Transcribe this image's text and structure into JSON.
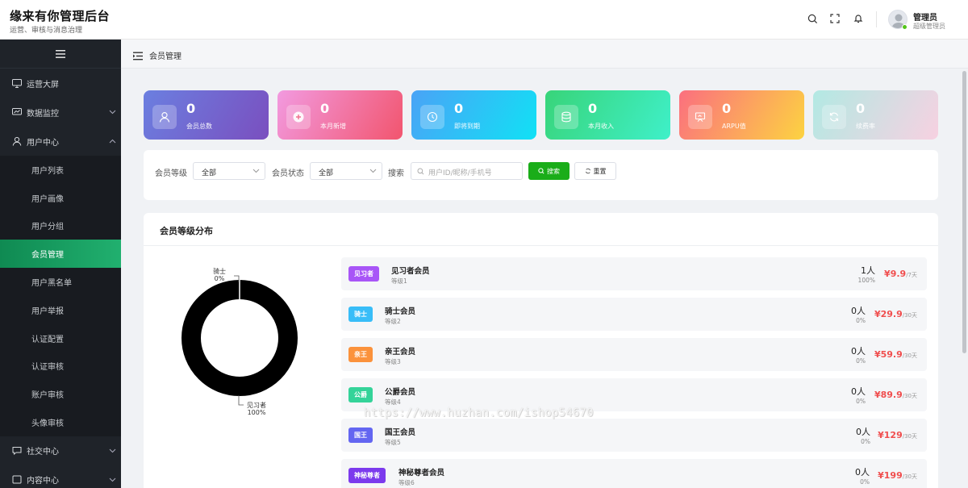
{
  "header": {
    "title": "缘来有你管理后台",
    "subtitle": "运营、审核与消息治理",
    "user_name": "管理员",
    "user_role": "超级管理员"
  },
  "sidebar": {
    "items": [
      {
        "label": "运营大屏",
        "icon": "monitor-icon"
      },
      {
        "label": "数据监控",
        "icon": "chart-icon"
      },
      {
        "label": "用户中心",
        "icon": "user-icon"
      },
      {
        "label": "社交中心",
        "icon": "chat-icon"
      },
      {
        "label": "内容中心",
        "icon": "content-icon"
      }
    ],
    "sub_items": [
      "用户列表",
      "用户画像",
      "用户分组",
      "会员管理",
      "用户黑名单",
      "用户举报",
      "认证配置",
      "认证审核",
      "账户审核",
      "头像审核"
    ],
    "active": "会员管理"
  },
  "breadcrumb": {
    "current": "会员管理"
  },
  "stats": [
    {
      "value": "0",
      "label": "会员总数",
      "icon": "user-icon"
    },
    {
      "value": "0",
      "label": "本月新增",
      "icon": "plus-icon"
    },
    {
      "value": "0",
      "label": "即将到期",
      "icon": "clock-icon"
    },
    {
      "value": "0",
      "label": "本月收入",
      "icon": "database-icon"
    },
    {
      "value": "0",
      "label": "ARPU值",
      "icon": "presentation-icon"
    },
    {
      "value": "0",
      "label": "续费率",
      "icon": "refresh-icon"
    }
  ],
  "filter": {
    "level_label": "会员等级",
    "level_value": "全部",
    "status_label": "会员状态",
    "status_value": "全部",
    "search_label": "搜索",
    "search_placeholder": "用户ID/昵称/手机号",
    "search_button": "搜索",
    "reset_button": "重置"
  },
  "distribution": {
    "title": "会员等级分布",
    "pie_labels": [
      {
        "name": "骑士",
        "pct": "0%"
      },
      {
        "name": "见习者",
        "pct": "100%"
      }
    ],
    "levels": [
      {
        "badge": "见习者",
        "name": "见习者会员",
        "grade": "等级1",
        "count": "1人",
        "pct": "100%",
        "price": "¥9.9",
        "period": "/7天",
        "color": "#a855f7"
      },
      {
        "badge": "骑士",
        "name": "骑士会员",
        "grade": "等级2",
        "count": "0人",
        "pct": "0%",
        "price": "¥29.9",
        "period": "/30天",
        "color": "#38bdf8"
      },
      {
        "badge": "亲王",
        "name": "亲王会员",
        "grade": "等级3",
        "count": "0人",
        "pct": "0%",
        "price": "¥59.9",
        "period": "/30天",
        "color": "#fb923c"
      },
      {
        "badge": "公爵",
        "name": "公爵会员",
        "grade": "等级4",
        "count": "0人",
        "pct": "0%",
        "price": "¥89.9",
        "period": "/30天",
        "color": "#34d399"
      },
      {
        "badge": "国王",
        "name": "国王会员",
        "grade": "等级5",
        "count": "0人",
        "pct": "0%",
        "price": "¥129",
        "period": "/30天",
        "color": "#6366f1"
      },
      {
        "badge": "神秘尊者",
        "name": "神秘尊者会员",
        "grade": "等级6",
        "count": "0人",
        "pct": "0%",
        "price": "¥199",
        "period": "/30天",
        "color": "#7c3aed"
      }
    ]
  },
  "watermark": "https://www.huzhan.com/ishop54670"
}
